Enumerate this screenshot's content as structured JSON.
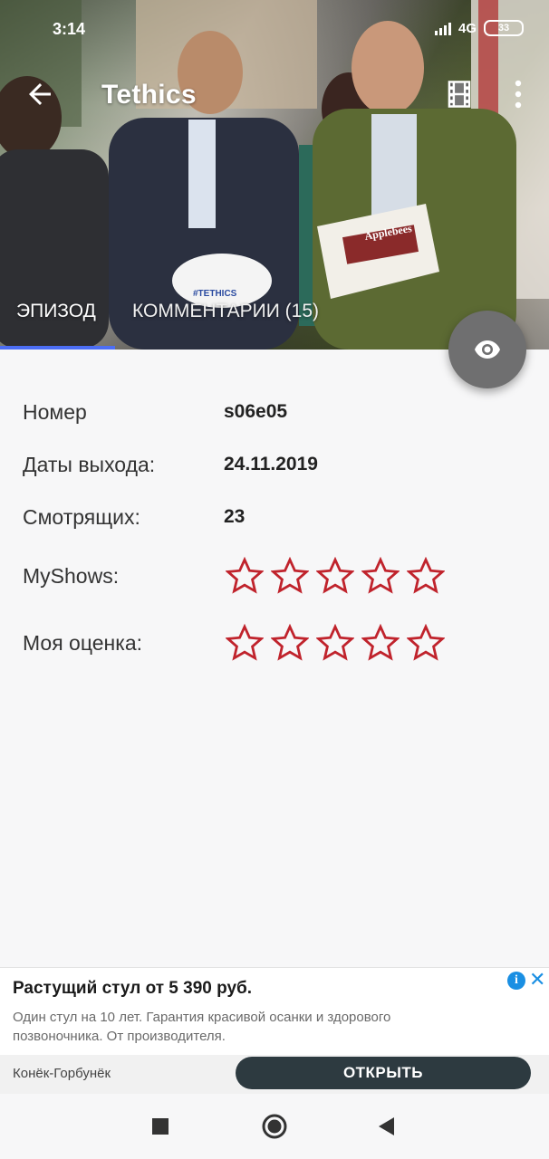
{
  "status_bar": {
    "time": "3:14",
    "network": "4G",
    "battery": "33"
  },
  "toolbar": {
    "title": "Tethics",
    "back_icon": "arrow-left-icon",
    "film_icon": "film-icon",
    "more_icon": "more-vert-icon"
  },
  "tabs": [
    {
      "label": "ЭПИЗОД",
      "active": true
    },
    {
      "label": "КОММЕНТАРИИ (15)",
      "active": false
    }
  ],
  "fab_icon": "eye-icon",
  "details": {
    "number": {
      "label": "Номер",
      "value": "s06e05"
    },
    "air_date": {
      "label": "Даты выхода:",
      "value": "24.11.2019"
    },
    "watchers": {
      "label": "Смотрящих:",
      "value": "23"
    },
    "myshows": {
      "label": "MyShows:",
      "rating": 0,
      "max": 5
    },
    "my_rating": {
      "label": "Моя оценка:",
      "rating": 0,
      "max": 5
    }
  },
  "ad": {
    "title": "Растущий стул от 5 390 руб.",
    "description": "Один стул на 10 лет. Гарантия красивой осанки и здорового позвоночника. От производителя.",
    "sponsor": "Конёк-Горбунёк",
    "button": "ОТКРЫТЬ",
    "info_icon": "info-icon",
    "close_icon": "close-icon"
  },
  "colors": {
    "accent": "#4c6ef5",
    "star_stroke": "#c0232c",
    "fab": "#6f6f70",
    "ad_button": "#2d3a40"
  }
}
